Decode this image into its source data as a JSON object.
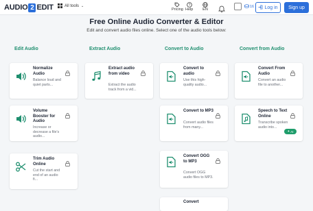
{
  "header": {
    "logo_left": "AUDIO",
    "logo_mid": "2",
    "logo_right": "EDIT",
    "all_tools": "All tools",
    "pricing": "Pricing",
    "help": "Help",
    "language": "EN",
    "credits": "16",
    "login": "Log in",
    "signup": "Sign up"
  },
  "page": {
    "title": "Free Online Audio Converter & Editor",
    "subtitle": "Edit and convert audio files online. Select one of the audio tools below:"
  },
  "columns": [
    {
      "heading": "Edit Audio",
      "cards": [
        {
          "icon": "volume-icon",
          "name": "Normalize Audio",
          "desc": "Balance loud and quiet parts..."
        },
        {
          "icon": "volume-icon",
          "name": "Volume Booster for Audio",
          "desc": "Increase or decrease a file's audio..."
        },
        {
          "icon": "scissors-icon",
          "name": "Trim Audio Online",
          "desc": "Cut the start and end of an audio fi..."
        }
      ]
    },
    {
      "heading": "Extract Audio",
      "cards": [
        {
          "icon": "music-note-icon",
          "name": "Extract audio from video",
          "desc": "Extract the audio track from a vid..."
        }
      ]
    },
    {
      "heading": "Convert to Audio",
      "cards": [
        {
          "icon": "audio-file-icon",
          "name": "Convert to audio",
          "desc": "Use this high-quality audio..."
        },
        {
          "icon": "audio-file-icon",
          "name": "Convert to MP3",
          "desc": "Convert audio files from many..."
        },
        {
          "icon": "audio-file-icon",
          "name": "Convert OGG to MP3",
          "desc": "Convert OGG audio files to MP3."
        },
        {
          "icon": "audio-file-icon",
          "name": "Convert",
          "desc": ""
        }
      ]
    },
    {
      "heading": "Convert from Audio",
      "cards": [
        {
          "icon": "audio-file-icon",
          "name": "Convert From Audio",
          "desc": "Convert an audio file to another..."
        },
        {
          "icon": "music-file-icon",
          "name": "Speech to Text Online",
          "desc": "Transcribe spoken audio into...",
          "badge": "AI"
        }
      ]
    }
  ],
  "colors": {
    "accent": "#2b6fda",
    "heading": "#1f8f6f",
    "badge": "#1f9d6b"
  }
}
